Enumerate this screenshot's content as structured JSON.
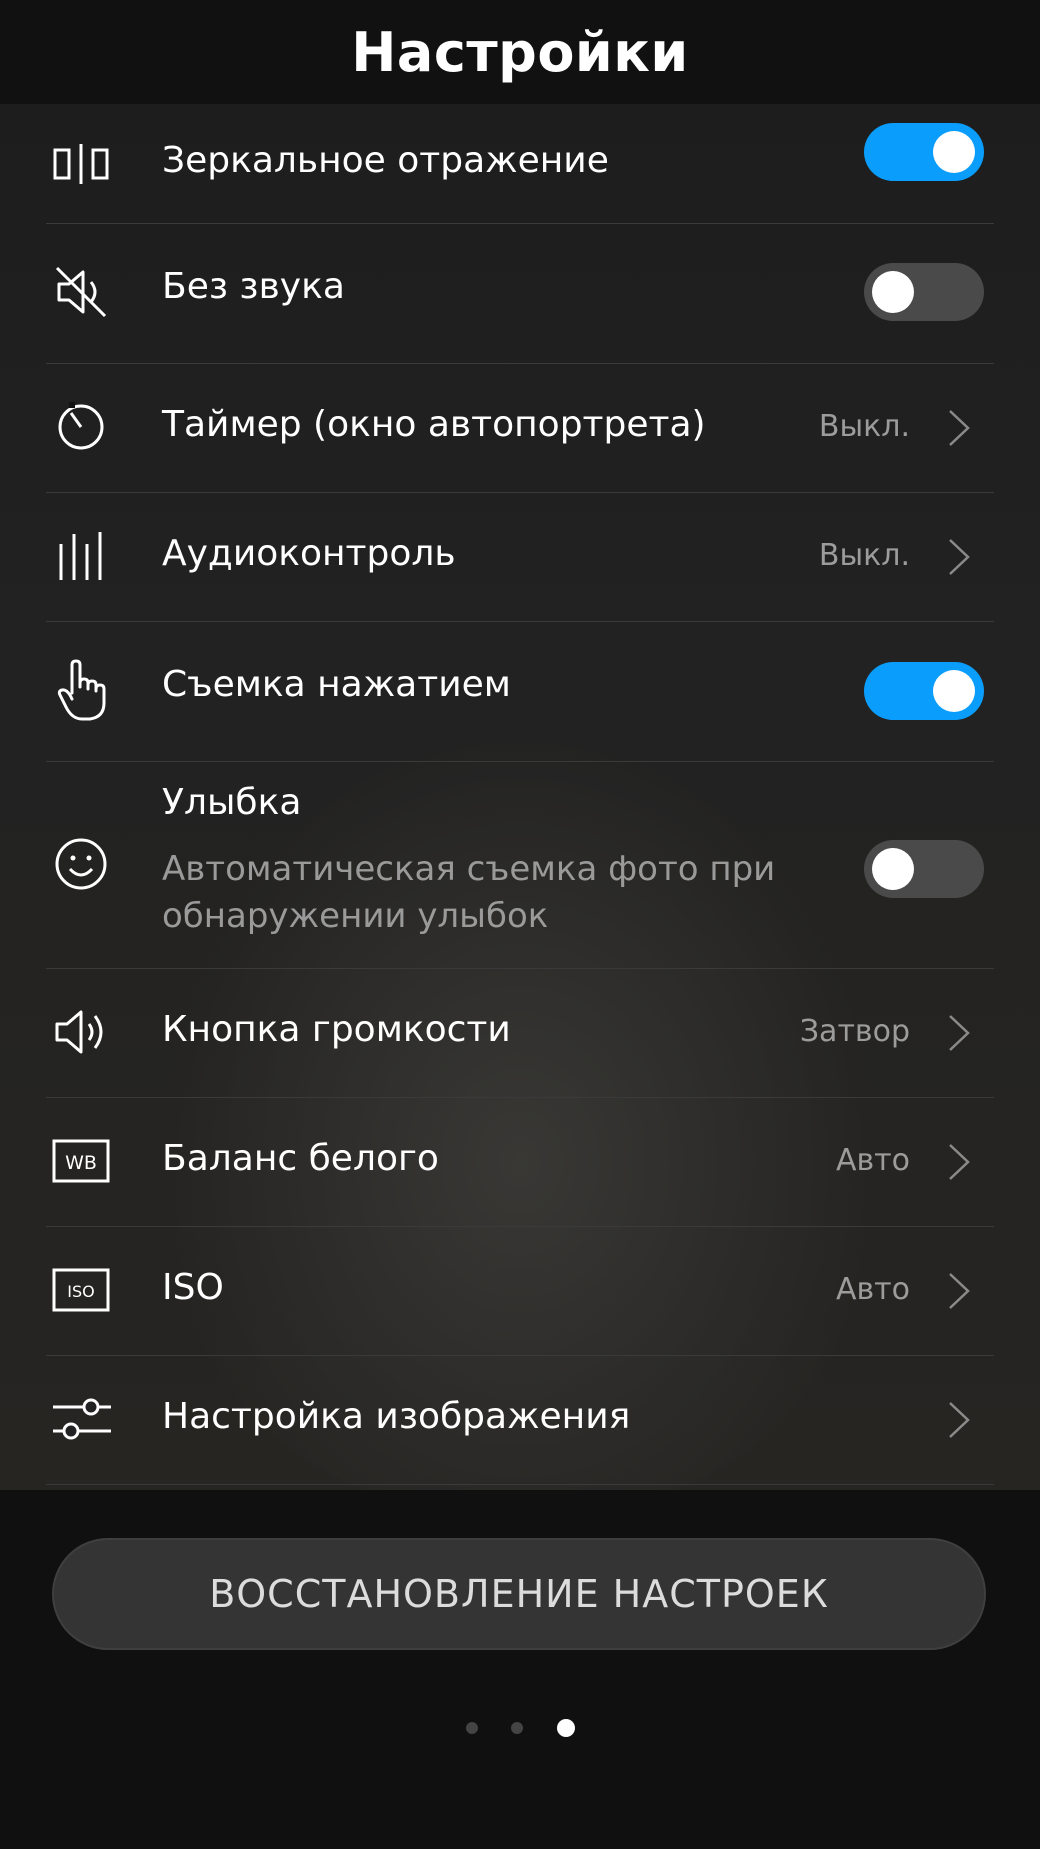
{
  "header": {
    "title": "Настройки"
  },
  "settings": [
    {
      "label": "Зеркальное отражение",
      "icon": "mirror-icon",
      "control": "toggle",
      "on": true
    },
    {
      "label": "Без звука",
      "icon": "mute-icon",
      "control": "toggle",
      "on": false
    },
    {
      "label": "Таймер (окно автопортрета)",
      "icon": "timer-icon",
      "control": "value",
      "value": "Выкл."
    },
    {
      "label": "Аудиоконтроль",
      "icon": "audio-bars-icon",
      "control": "value",
      "value": "Выкл."
    },
    {
      "label": "Съемка нажатием",
      "icon": "touch-hand-icon",
      "control": "toggle",
      "on": true
    },
    {
      "label": "Улыбка",
      "sub": "Автоматическая съемка фото при обнаружении улыбок",
      "icon": "smile-icon",
      "control": "toggle",
      "on": false
    },
    {
      "label": "Кнопка громкости",
      "icon": "speaker-icon",
      "control": "value",
      "value": "Затвор"
    },
    {
      "label": "Баланс белого",
      "icon": "white-balance-icon",
      "icon_text": "WB",
      "control": "value",
      "value": "Авто"
    },
    {
      "label": "ISO",
      "icon": "iso-icon",
      "icon_text": "ISO",
      "control": "value",
      "value": "Авто"
    },
    {
      "label": "Настройка изображения",
      "icon": "sliders-icon",
      "control": "chevron"
    }
  ],
  "reset_button": {
    "label": "ВОССТАНОВЛЕНИЕ НАСТРОЕК"
  },
  "pager": {
    "pages": 3,
    "active": 3
  },
  "colors": {
    "accent": "#0b9dfb",
    "toggle_off": "#4a4a4a",
    "background": "#101010"
  }
}
